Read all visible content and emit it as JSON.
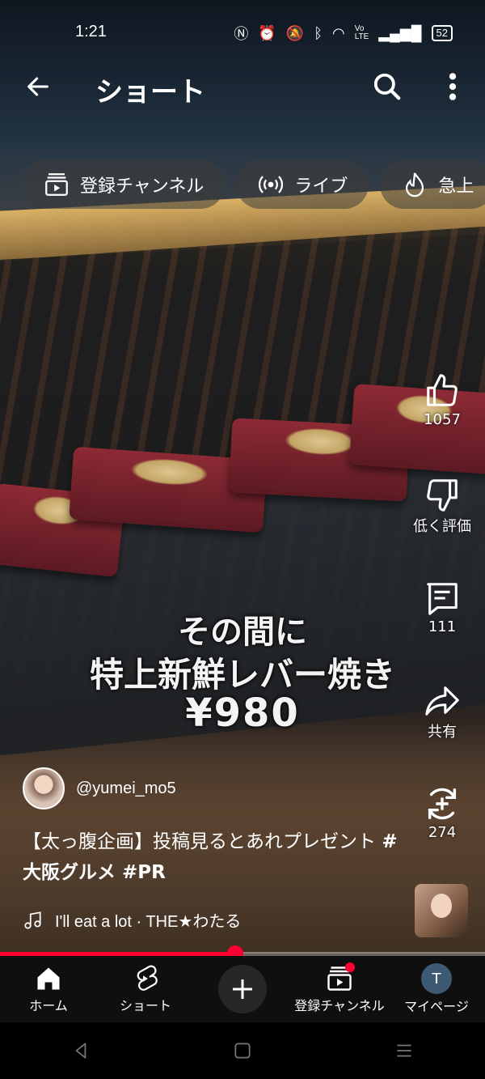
{
  "status_bar": {
    "time": "1:21",
    "battery": "52",
    "icons": [
      "nfc-icon",
      "alarm-icon",
      "mute-icon",
      "bluetooth-icon",
      "wifi-icon",
      "volte-icon",
      "signal-icon",
      "battery-icon"
    ]
  },
  "header": {
    "title": "ショート"
  },
  "chips": [
    {
      "label": "登録チャンネル",
      "icon": "subscriptions-icon"
    },
    {
      "label": "ライブ",
      "icon": "live-icon"
    },
    {
      "label": "急上",
      "icon": "trending-icon"
    }
  ],
  "video": {
    "overlay_lines": [
      "その間に",
      "特上新鮮レバー焼き",
      "¥980"
    ],
    "author": "@yumei_mo5",
    "caption_text": "【太っ腹企画】投稿見るとあれプレゼント",
    "caption_tags": "#大阪グルメ #PR",
    "music": "I'll eat a lot · THE★わたる",
    "progress_fraction": 0.485
  },
  "actions": {
    "like_count": "1057",
    "dislike_label": "低く評価",
    "comment_count": "111",
    "share_label": "共有",
    "remix_count": "274"
  },
  "bottom_nav": {
    "home": "ホーム",
    "shorts": "ショート",
    "subscriptions": "登録チャンネル",
    "mypage": "マイページ",
    "avatar_letter": "T"
  },
  "colors": {
    "accent": "#ff0033",
    "nav_bg": "#0f0f0f"
  }
}
